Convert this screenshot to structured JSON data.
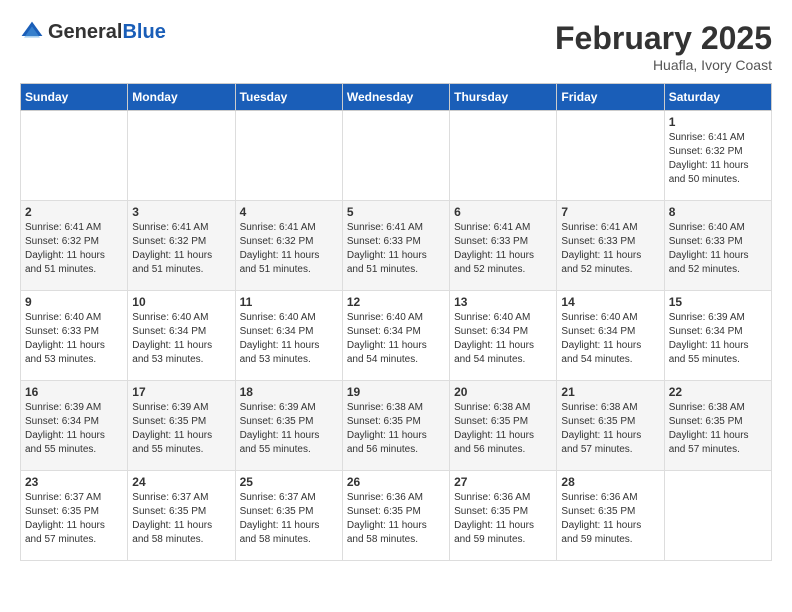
{
  "header": {
    "logo_general": "General",
    "logo_blue": "Blue",
    "main_title": "February 2025",
    "subtitle": "Huafla, Ivory Coast"
  },
  "weekdays": [
    "Sunday",
    "Monday",
    "Tuesday",
    "Wednesday",
    "Thursday",
    "Friday",
    "Saturday"
  ],
  "weeks": [
    [
      {
        "day": "",
        "info": ""
      },
      {
        "day": "",
        "info": ""
      },
      {
        "day": "",
        "info": ""
      },
      {
        "day": "",
        "info": ""
      },
      {
        "day": "",
        "info": ""
      },
      {
        "day": "",
        "info": ""
      },
      {
        "day": "1",
        "info": "Sunrise: 6:41 AM\nSunset: 6:32 PM\nDaylight: 11 hours\nand 50 minutes."
      }
    ],
    [
      {
        "day": "2",
        "info": "Sunrise: 6:41 AM\nSunset: 6:32 PM\nDaylight: 11 hours\nand 51 minutes."
      },
      {
        "day": "3",
        "info": "Sunrise: 6:41 AM\nSunset: 6:32 PM\nDaylight: 11 hours\nand 51 minutes."
      },
      {
        "day": "4",
        "info": "Sunrise: 6:41 AM\nSunset: 6:32 PM\nDaylight: 11 hours\nand 51 minutes."
      },
      {
        "day": "5",
        "info": "Sunrise: 6:41 AM\nSunset: 6:33 PM\nDaylight: 11 hours\nand 51 minutes."
      },
      {
        "day": "6",
        "info": "Sunrise: 6:41 AM\nSunset: 6:33 PM\nDaylight: 11 hours\nand 52 minutes."
      },
      {
        "day": "7",
        "info": "Sunrise: 6:41 AM\nSunset: 6:33 PM\nDaylight: 11 hours\nand 52 minutes."
      },
      {
        "day": "8",
        "info": "Sunrise: 6:40 AM\nSunset: 6:33 PM\nDaylight: 11 hours\nand 52 minutes."
      }
    ],
    [
      {
        "day": "9",
        "info": "Sunrise: 6:40 AM\nSunset: 6:33 PM\nDaylight: 11 hours\nand 53 minutes."
      },
      {
        "day": "10",
        "info": "Sunrise: 6:40 AM\nSunset: 6:34 PM\nDaylight: 11 hours\nand 53 minutes."
      },
      {
        "day": "11",
        "info": "Sunrise: 6:40 AM\nSunset: 6:34 PM\nDaylight: 11 hours\nand 53 minutes."
      },
      {
        "day": "12",
        "info": "Sunrise: 6:40 AM\nSunset: 6:34 PM\nDaylight: 11 hours\nand 54 minutes."
      },
      {
        "day": "13",
        "info": "Sunrise: 6:40 AM\nSunset: 6:34 PM\nDaylight: 11 hours\nand 54 minutes."
      },
      {
        "day": "14",
        "info": "Sunrise: 6:40 AM\nSunset: 6:34 PM\nDaylight: 11 hours\nand 54 minutes."
      },
      {
        "day": "15",
        "info": "Sunrise: 6:39 AM\nSunset: 6:34 PM\nDaylight: 11 hours\nand 55 minutes."
      }
    ],
    [
      {
        "day": "16",
        "info": "Sunrise: 6:39 AM\nSunset: 6:34 PM\nDaylight: 11 hours\nand 55 minutes."
      },
      {
        "day": "17",
        "info": "Sunrise: 6:39 AM\nSunset: 6:35 PM\nDaylight: 11 hours\nand 55 minutes."
      },
      {
        "day": "18",
        "info": "Sunrise: 6:39 AM\nSunset: 6:35 PM\nDaylight: 11 hours\nand 55 minutes."
      },
      {
        "day": "19",
        "info": "Sunrise: 6:38 AM\nSunset: 6:35 PM\nDaylight: 11 hours\nand 56 minutes."
      },
      {
        "day": "20",
        "info": "Sunrise: 6:38 AM\nSunset: 6:35 PM\nDaylight: 11 hours\nand 56 minutes."
      },
      {
        "day": "21",
        "info": "Sunrise: 6:38 AM\nSunset: 6:35 PM\nDaylight: 11 hours\nand 57 minutes."
      },
      {
        "day": "22",
        "info": "Sunrise: 6:38 AM\nSunset: 6:35 PM\nDaylight: 11 hours\nand 57 minutes."
      }
    ],
    [
      {
        "day": "23",
        "info": "Sunrise: 6:37 AM\nSunset: 6:35 PM\nDaylight: 11 hours\nand 57 minutes."
      },
      {
        "day": "24",
        "info": "Sunrise: 6:37 AM\nSunset: 6:35 PM\nDaylight: 11 hours\nand 58 minutes."
      },
      {
        "day": "25",
        "info": "Sunrise: 6:37 AM\nSunset: 6:35 PM\nDaylight: 11 hours\nand 58 minutes."
      },
      {
        "day": "26",
        "info": "Sunrise: 6:36 AM\nSunset: 6:35 PM\nDaylight: 11 hours\nand 58 minutes."
      },
      {
        "day": "27",
        "info": "Sunrise: 6:36 AM\nSunset: 6:35 PM\nDaylight: 11 hours\nand 59 minutes."
      },
      {
        "day": "28",
        "info": "Sunrise: 6:36 AM\nSunset: 6:35 PM\nDaylight: 11 hours\nand 59 minutes."
      },
      {
        "day": "",
        "info": ""
      }
    ]
  ]
}
